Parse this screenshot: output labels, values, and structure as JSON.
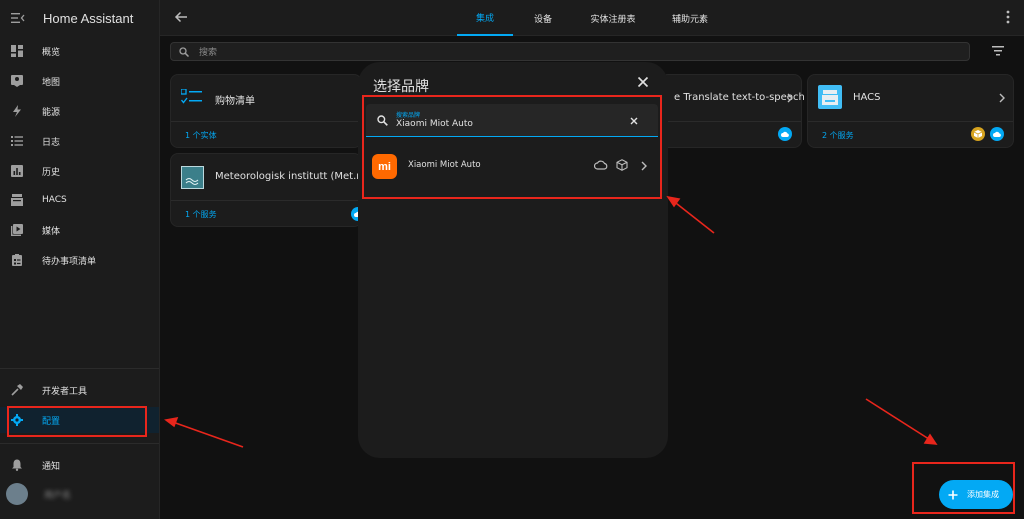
{
  "sidebar": {
    "title": "Home Assistant",
    "items": [
      {
        "label": "概览",
        "icon": "dashboard-icon"
      },
      {
        "label": "地图",
        "icon": "map-icon"
      },
      {
        "label": "能源",
        "icon": "energy-icon"
      },
      {
        "label": "日志",
        "icon": "logbook-icon"
      },
      {
        "label": "历史",
        "icon": "history-icon"
      },
      {
        "label": "HACS",
        "icon": "hacs-icon"
      },
      {
        "label": "媒体",
        "icon": "media-icon"
      },
      {
        "label": "待办事项清单",
        "icon": "todo-icon"
      }
    ],
    "dev_tools": "开发者工具",
    "settings": "配置",
    "notifications": "通知",
    "user": "用户名"
  },
  "topbar": {
    "tabs": [
      "集成",
      "设备",
      "实体注册表",
      "辅助元素"
    ],
    "active_tab": "集成"
  },
  "search": {
    "placeholder": "搜索"
  },
  "cards": [
    {
      "title": "购物清单",
      "footer": "1 个实体"
    },
    {
      "title": "Meteorologisk institutt (Met.no)",
      "footer": "1 个服务"
    },
    {
      "title": "e Translate text-to-speech",
      "footer": ""
    },
    {
      "title": "HACS",
      "footer": "2 个服务"
    }
  ],
  "dialog": {
    "title": "选择品牌",
    "field_label": "搜索品牌",
    "field_value": "Xiaomi Miot Auto",
    "result": {
      "name": "Xiaomi Miot Auto",
      "logo_text": "mi"
    }
  },
  "fab": {
    "label": "添加集成"
  },
  "colors": {
    "accent": "#03a9f4",
    "annotation": "#e8261c",
    "brand_orange": "#ff6900",
    "background": "#111111",
    "surface": "#1c1c1c"
  }
}
